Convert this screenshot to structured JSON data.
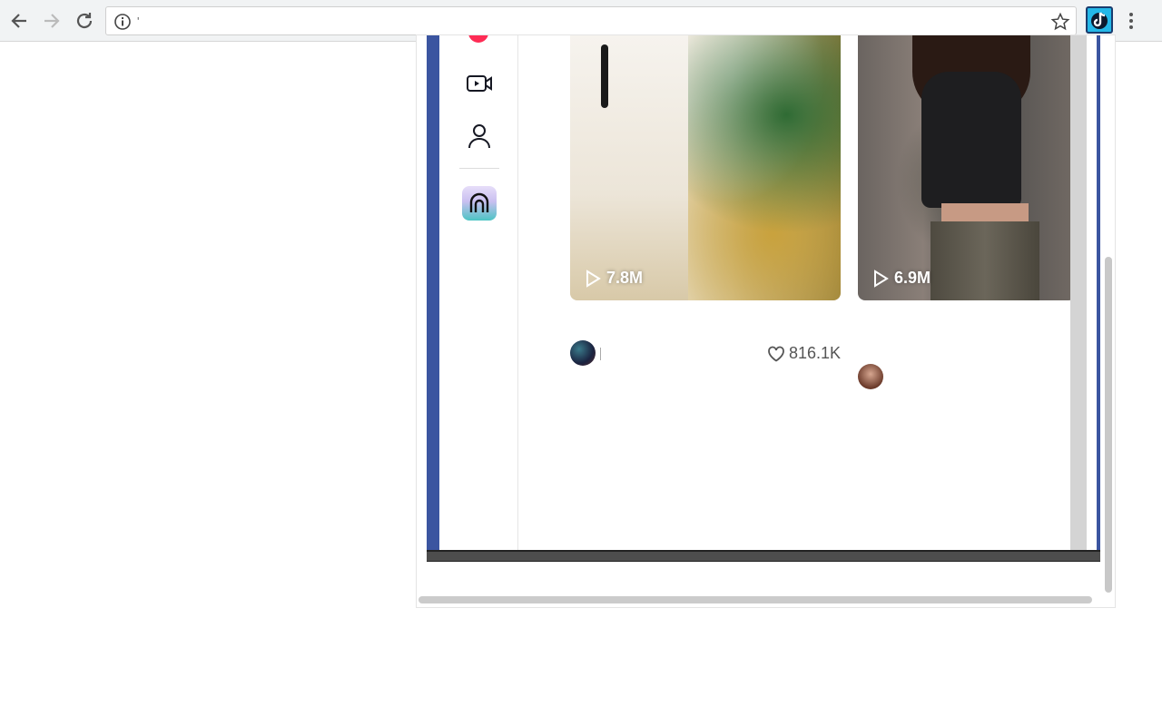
{
  "browser": {
    "address_text": "'",
    "icons": [
      "back-arrow-icon",
      "forward-arrow-icon",
      "reload-icon",
      "info-icon",
      "star-icon",
      "extension-icon",
      "menu-dots-icon"
    ]
  },
  "sidebar": {
    "icons": [
      "video-camera-icon",
      "profile-icon",
      "promo-icon"
    ]
  },
  "feed": {
    "cards": [
      {
        "views": "7.8M"
      },
      {
        "views": "6.9M"
      }
    ],
    "likes": "816.1K"
  },
  "colors": {
    "frame_border": "#3b55a0",
    "brand_red": "#fe2c55"
  }
}
